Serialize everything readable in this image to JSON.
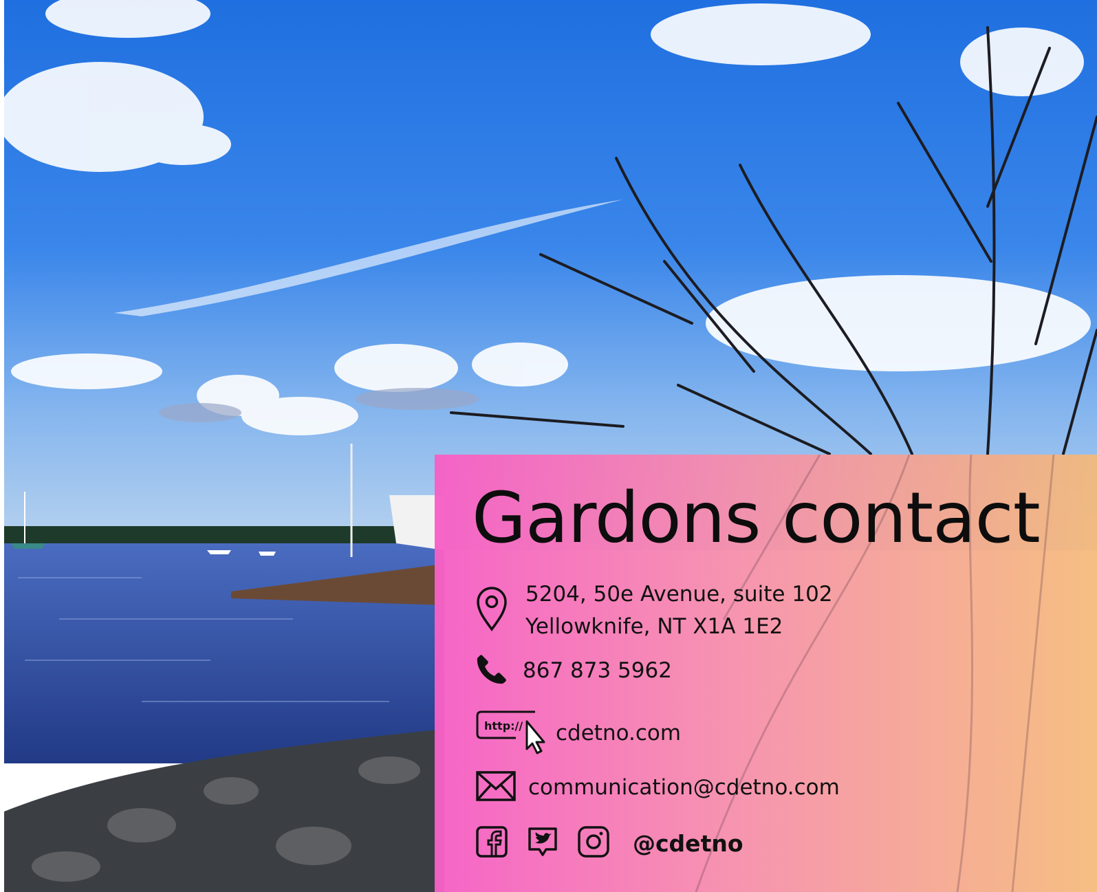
{
  "title": "Gardons contact",
  "address": {
    "line1": "5204, 50e Avenue, suite 102",
    "line2": "Yellowknife, NT X1A 1E2",
    "icon": "location-pin-icon"
  },
  "phone": {
    "value": "867 873 5962",
    "icon": "phone-icon"
  },
  "website": {
    "value": "cdetno.com",
    "icon": "web-link-icon",
    "icon_text": "http://"
  },
  "email": {
    "value": "communication@cdetno.com",
    "icon": "envelope-icon"
  },
  "social": {
    "handle": "@cdetno",
    "icons": [
      "facebook-icon",
      "twitter-icon",
      "instagram-icon"
    ]
  },
  "colors": {
    "panel_left": "#f660c6",
    "panel_right": "#f5b978",
    "sky": "#2f7ee6",
    "water": "#3e5ea8",
    "text": "#111111"
  }
}
